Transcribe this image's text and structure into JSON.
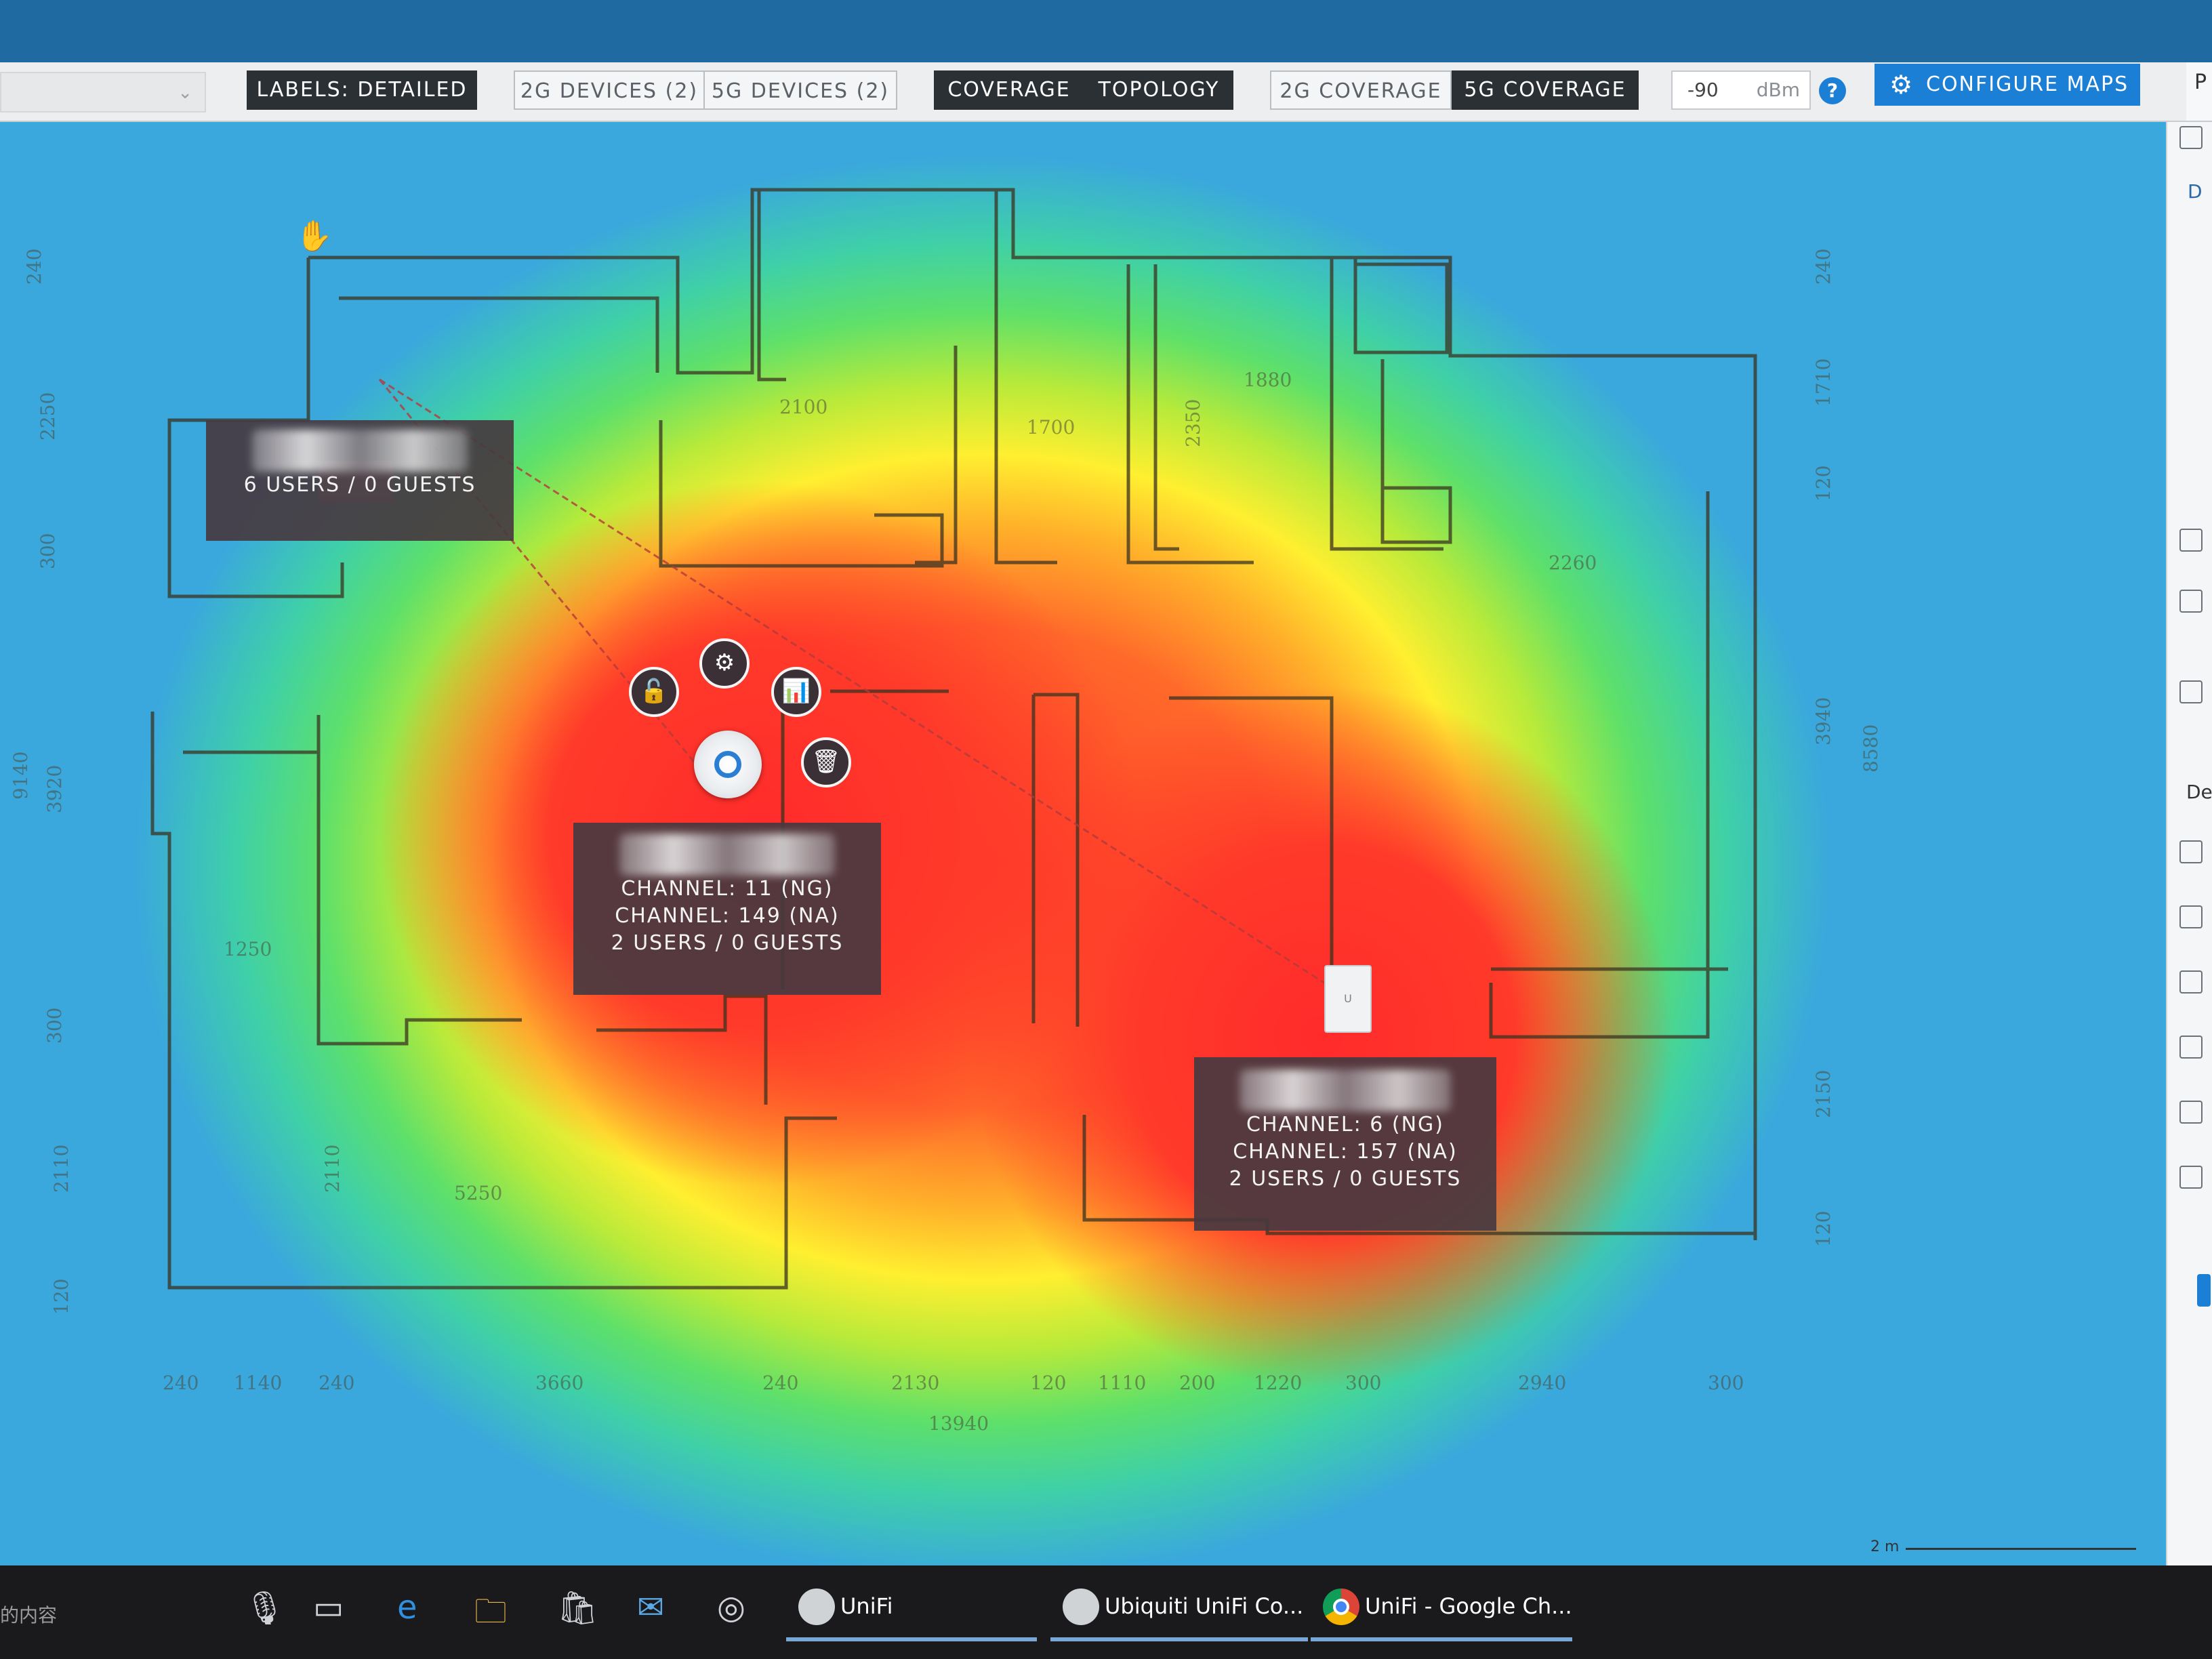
{
  "toolbar": {
    "labels_button": "LABELS: DETAILED",
    "devices_2g": "2G DEVICES (2)",
    "devices_5g": "5G DEVICES (2)",
    "coverage": "COVERAGE",
    "topology": "TOPOLOGY",
    "coverage_2g": "2G COVERAGE",
    "coverage_5g": "5G COVERAGE",
    "dbm_value": "-90",
    "dbm_unit": "dBm",
    "help": "?",
    "configure_maps": "CONFIGURE MAPS",
    "panel_tab": "P",
    "active_toggles": [
      "LABELS: DETAILED",
      "COVERAGE",
      "TOPOLOGY",
      "5G COVERAGE"
    ]
  },
  "devices": [
    {
      "name": "switch",
      "stats": "6 USERS / 0 GUESTS"
    },
    {
      "name": "ap-1",
      "name_fragment": "M",
      "channel_ng": "CHANNEL: 11 (NG)",
      "channel_na": "CHANNEL: 149 (NA)",
      "stats": "2 USERS / 0 GUESTS"
    },
    {
      "name": "ap-2",
      "channel_ng": "CHANNEL: 6 (NG)",
      "channel_na": "CHANNEL: 157 (NA)",
      "stats": "2 USERS / 0 GUESTS"
    }
  ],
  "ap_actions": [
    "lock-icon",
    "settings-icon",
    "stats-icon",
    "delete-icon"
  ],
  "floorplan_dimensions": {
    "left": [
      "240",
      "2250",
      "300",
      "9140",
      "3920",
      "300",
      "2110",
      "120"
    ],
    "right": [
      "240",
      "1710",
      "120",
      "3940",
      "8580",
      "2150",
      "120"
    ],
    "bottom": [
      "240",
      "1140",
      "240",
      "3660",
      "240",
      "2130",
      "120",
      "1110",
      "200",
      "1220",
      "300",
      "2940",
      "300"
    ],
    "total": "13940",
    "rooms": [
      "2100",
      "1700",
      "2350",
      "1880",
      "2260",
      "1250",
      "5250",
      "2110"
    ]
  },
  "scale": "2 m",
  "right_panel": {
    "text_1": "D",
    "text_2": "De"
  },
  "taskbar": {
    "search_text": "的内容",
    "apps": [
      {
        "label": "UniFi"
      },
      {
        "label": "Ubiquiti UniFi Co..."
      },
      {
        "label": "UniFi - Google Ch..."
      }
    ]
  },
  "colors": {
    "heat_strong": "#ff2b2b",
    "heat_mid": "#ffef30",
    "heat_weak": "#5ee06a",
    "accent": "#1c7fd6",
    "label_bg": "#463a40"
  }
}
